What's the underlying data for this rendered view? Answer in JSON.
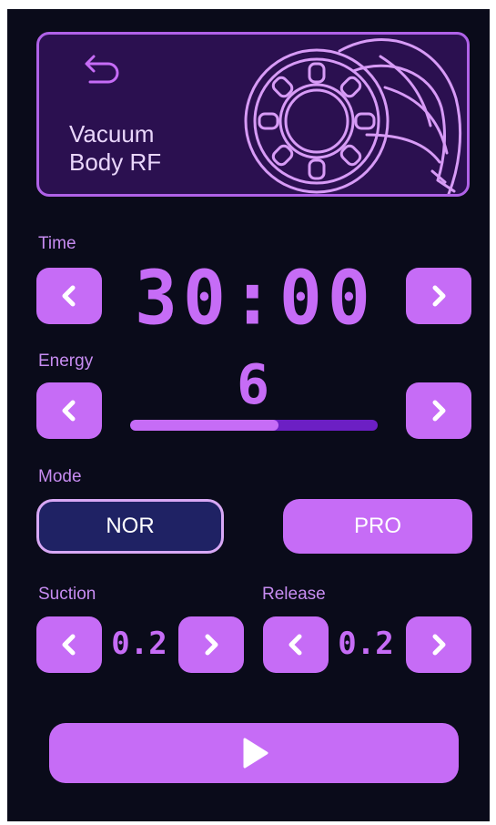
{
  "header": {
    "title_line1": "Vacuum",
    "title_line2": "Body RF",
    "back_icon": "back-arrow-icon",
    "device_image": "rf-handpiece-illustration"
  },
  "time": {
    "label": "Time",
    "value": "30:00",
    "decrease_icon": "chevron-left-icon",
    "increase_icon": "chevron-right-icon"
  },
  "energy": {
    "label": "Energy",
    "value": "6",
    "level_fraction": 0.6
  },
  "mode": {
    "label": "Mode",
    "options": [
      "NOR",
      "PRO"
    ],
    "selected": "NOR"
  },
  "suction": {
    "label": "Suction",
    "value": "0.2"
  },
  "release": {
    "label": "Release",
    "value": "0.2"
  },
  "start": {
    "icon": "play-icon"
  },
  "colors": {
    "background": "#0a0b1a",
    "accent": "#c66cf6",
    "header_bg": "#2b1050",
    "selected_mode": "#1f2264"
  }
}
